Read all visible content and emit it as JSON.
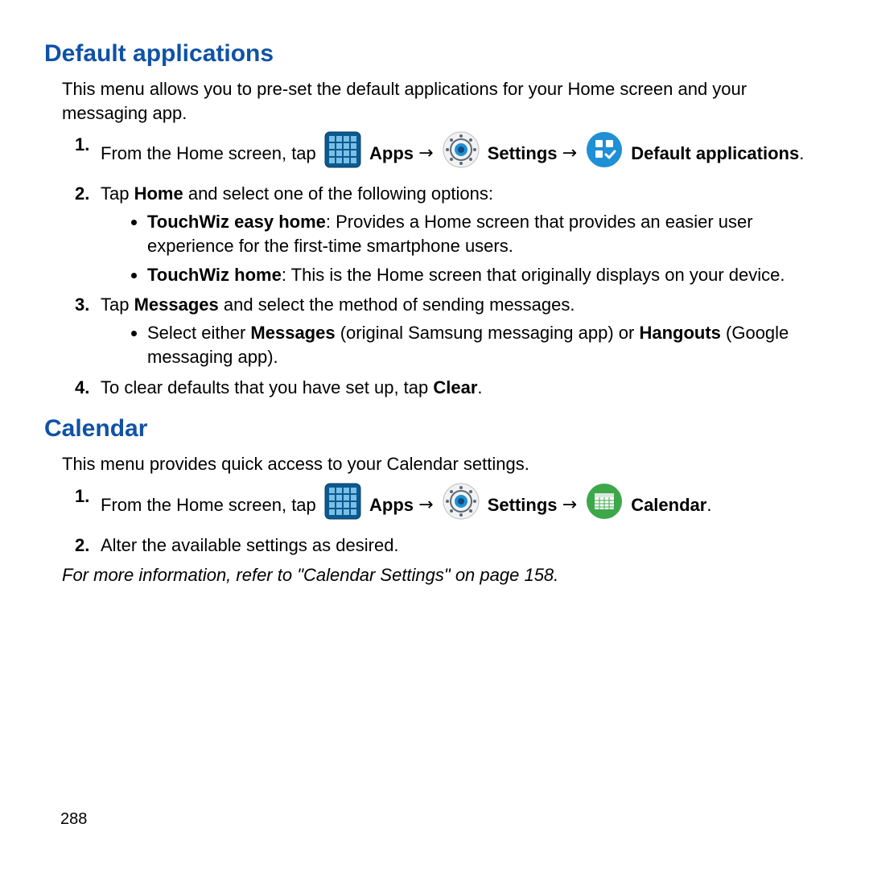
{
  "section1": {
    "heading": "Default applications",
    "intro": "This menu allows you to pre-set the default applications for your Home screen and your messaging app.",
    "step1_a": "From the Home screen, tap ",
    "step1_apps": "Apps",
    "arrow": " → ",
    "step1_settings": "Settings",
    "step1_default": "Default applications",
    "step1_period": ".",
    "step2_a": "Tap ",
    "step2_home": "Home",
    "step2_b": " and select one of the following options:",
    "step2_opt1_b": "TouchWiz easy home",
    "step2_opt1_t": ": Provides a Home screen that provides an easier user experience for the first-time smartphone users.",
    "step2_opt2_b": "TouchWiz home",
    "step2_opt2_t": ": This is the Home screen that originally displays on your device.",
    "step3_a": "Tap ",
    "step3_msgs": "Messages",
    "step3_b": " and select the method of sending messages.",
    "step3_sub_a": "Select either ",
    "step3_sub_msgs": "Messages",
    "step3_sub_mid": " (original Samsung messaging app) or ",
    "step3_sub_hangouts": "Hangouts",
    "step3_sub_end": " (Google messaging app).",
    "step4_a": "To clear defaults that you have set up, tap ",
    "step4_clear": "Clear",
    "step4_end": "."
  },
  "section2": {
    "heading": "Calendar",
    "intro": "This menu provides quick access to your Calendar settings.",
    "step1_a": "From the Home screen, tap ",
    "step1_apps": "Apps",
    "arrow": " → ",
    "step1_settings": "Settings",
    "step1_calendar": "Calendar",
    "step1_period": ".",
    "step2": "Alter the available settings as desired.",
    "ref": "For more information, refer to \"Calendar Settings\" on page 158."
  },
  "page_number": "288"
}
